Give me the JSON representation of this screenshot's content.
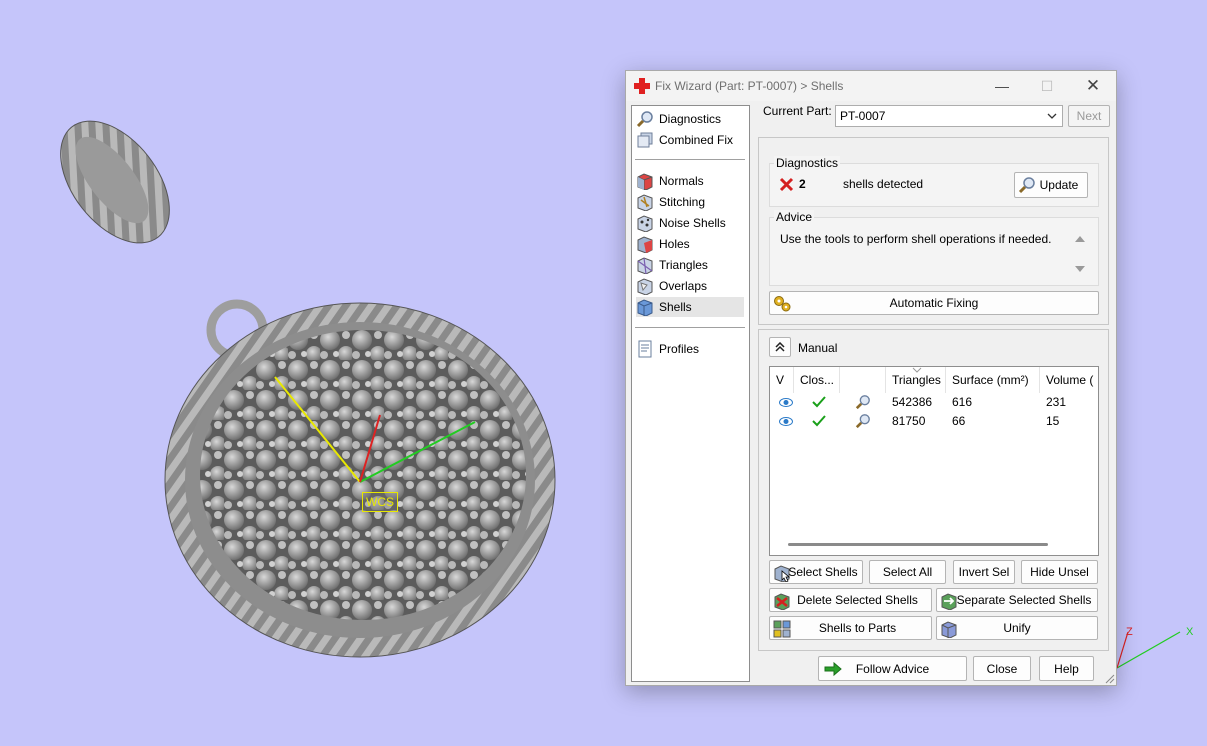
{
  "window": {
    "title": "Fix Wizard (Part: PT-0007) > Shells",
    "controls": {
      "minimize": "—",
      "maximize": "☐",
      "close": "✕"
    }
  },
  "viewport": {
    "wcs_label": "WCS",
    "axis_z": "Z",
    "axis_x": "X",
    "colors": {
      "background": "#c5c5fa",
      "model": "#8c8c8c",
      "axis_x": "#22cc22",
      "axis_y": "#e8e800",
      "axis_z": "#dd2222"
    }
  },
  "sidebar": {
    "groups": [
      [
        {
          "label": "Diagnostics",
          "icon": "magnifier-icon"
        },
        {
          "label": "Combined Fix",
          "icon": "combined-fix-icon"
        }
      ],
      [
        {
          "label": "Normals",
          "icon": "normals-icon"
        },
        {
          "label": "Stitching",
          "icon": "stitching-icon"
        },
        {
          "label": "Noise Shells",
          "icon": "noise-shells-icon"
        },
        {
          "label": "Holes",
          "icon": "holes-icon"
        },
        {
          "label": "Triangles",
          "icon": "triangles-icon"
        },
        {
          "label": "Overlaps",
          "icon": "overlaps-icon"
        },
        {
          "label": "Shells",
          "icon": "shells-icon",
          "selected": true
        }
      ],
      [
        {
          "label": "Profiles",
          "icon": "profiles-icon"
        }
      ]
    ]
  },
  "current_part": {
    "label": "Current Part:",
    "value": "PT-0007",
    "next_label": "Next"
  },
  "diagnostics": {
    "title": "Diagnostics",
    "count": "2",
    "status_text": "shells detected",
    "update_label": "Update"
  },
  "advice": {
    "title": "Advice",
    "text": "Use the tools to perform shell operations if needed."
  },
  "automatic_fixing_label": "Automatic Fixing",
  "manual": {
    "label": "Manual",
    "columns": [
      "V",
      "Clos...",
      "",
      "Triangles",
      "Surface (mm²)",
      "Volume ("
    ],
    "rows": [
      {
        "visible": true,
        "closed": true,
        "triangles": "542386",
        "surface": "616",
        "volume": "231"
      },
      {
        "visible": true,
        "closed": true,
        "triangles": "81750",
        "surface": "66",
        "volume": "15"
      }
    ],
    "buttons": {
      "select_shells": "Select Shells",
      "select_all": "Select All",
      "invert_sel": "Invert Sel",
      "hide_unsel": "Hide Unsel",
      "delete_selected": "Delete Selected Shells",
      "separate_selected": "Separate Selected Shells",
      "shells_to_parts": "Shells to Parts",
      "unify": "Unify"
    }
  },
  "footer": {
    "follow_advice": "Follow Advice",
    "close": "Close",
    "help": "Help"
  }
}
